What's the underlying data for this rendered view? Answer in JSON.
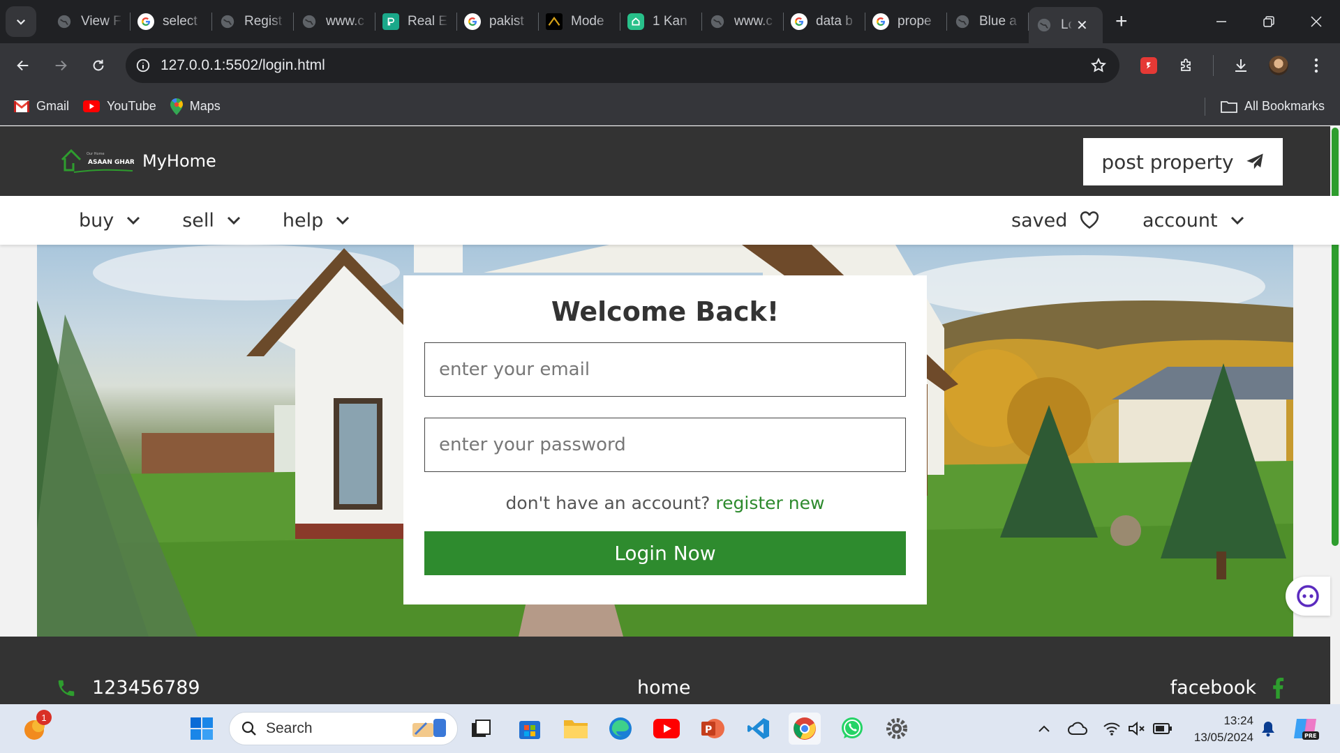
{
  "browser": {
    "tabs": [
      {
        "title": "View F",
        "favicon": "globe-icon"
      },
      {
        "title": "select",
        "favicon": "google-icon"
      },
      {
        "title": "Regist",
        "favicon": "globe-icon"
      },
      {
        "title": "www.c",
        "favicon": "globe-icon"
      },
      {
        "title": "Real E",
        "favicon": "realestate-icon"
      },
      {
        "title": "pakist",
        "favicon": "google-icon"
      },
      {
        "title": "Mode",
        "favicon": "model-icon"
      },
      {
        "title": "1 Kan",
        "favicon": "zameen-icon"
      },
      {
        "title": "www.c",
        "favicon": "globe-icon"
      },
      {
        "title": "data b",
        "favicon": "google-icon"
      },
      {
        "title": "prope",
        "favicon": "google-icon"
      },
      {
        "title": "Blue a",
        "favicon": "globe-icon"
      },
      {
        "title": "Lo",
        "favicon": "globe-icon",
        "active": true
      }
    ],
    "url": "127.0.0.1:5502/login.html",
    "bookmarks": [
      {
        "label": "Gmail",
        "icon": "gmail-icon"
      },
      {
        "label": "YouTube",
        "icon": "youtube-icon"
      },
      {
        "label": "Maps",
        "icon": "maps-icon"
      }
    ],
    "all_bookmarks": "All Bookmarks"
  },
  "site": {
    "brand": "MyHome",
    "logo_text": "ASAAN GHAR",
    "post_property": "post property",
    "nav": {
      "buy": "buy",
      "sell": "sell",
      "help": "help",
      "saved": "saved",
      "account": "account"
    },
    "login": {
      "title": "Welcome Back!",
      "email_placeholder": "enter your email",
      "password_placeholder": "enter your password",
      "no_account": "don't have an account?",
      "register": "register new",
      "submit": "Login Now"
    },
    "footer": {
      "phone": "123456789",
      "home": "home",
      "facebook": "facebook"
    }
  },
  "taskbar": {
    "search": "Search",
    "notification_count": "1",
    "time": "13:24",
    "date": "13/05/2024"
  },
  "colors": {
    "accent_green": "#2e8b2e",
    "header_dark": "#333333",
    "chrome_dark": "#202124"
  }
}
